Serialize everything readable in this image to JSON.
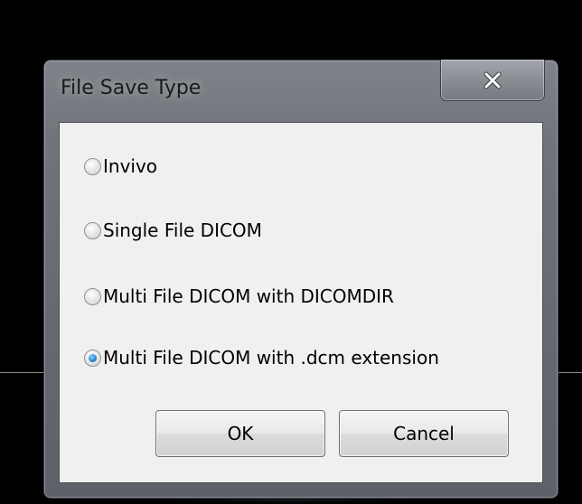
{
  "dialog": {
    "title": "File Save Type",
    "close_icon": "close-x-icon"
  },
  "options": [
    {
      "label": "Invivo",
      "selected": false
    },
    {
      "label": "Single File DICOM",
      "selected": false
    },
    {
      "label": "Multi File DICOM with DICOMDIR",
      "selected": false
    },
    {
      "label": "Multi File DICOM with .dcm extension",
      "selected": true
    }
  ],
  "buttons": {
    "ok_label": "OK",
    "cancel_label": "Cancel"
  },
  "colors": {
    "background": "#000000",
    "client_area": "#f0f0f0",
    "radio_selected": "#2a8ad4"
  }
}
